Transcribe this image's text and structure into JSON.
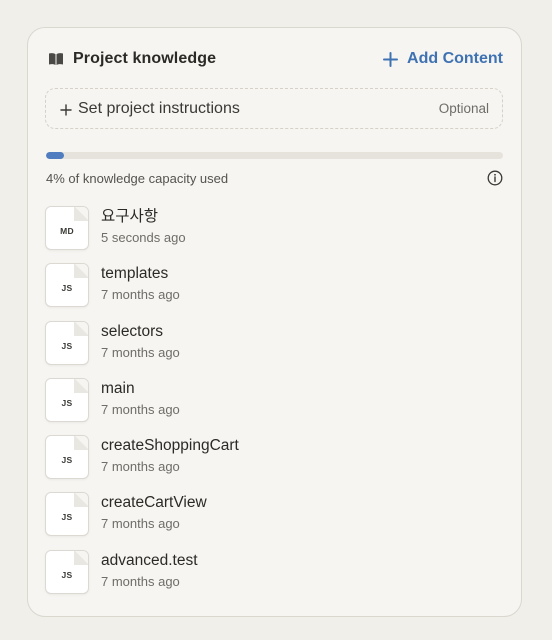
{
  "header": {
    "title": "Project knowledge",
    "add_label": "Add Content"
  },
  "instructions": {
    "label": "Set project instructions",
    "optional": "Optional"
  },
  "capacity": {
    "percent": 4,
    "text": "4% of knowledge capacity used"
  },
  "colors": {
    "accent": "#3f72b3",
    "bar_fill": "#4f7dbf",
    "background": "#f1efea"
  },
  "files": [
    {
      "ext": "MD",
      "name": "요구사항",
      "time": "5 seconds ago"
    },
    {
      "ext": "JS",
      "name": "templates",
      "time": "7 months ago"
    },
    {
      "ext": "JS",
      "name": "selectors",
      "time": "7 months ago"
    },
    {
      "ext": "JS",
      "name": "main",
      "time": "7 months ago"
    },
    {
      "ext": "JS",
      "name": "createShoppingCart",
      "time": "7 months ago"
    },
    {
      "ext": "JS",
      "name": "createCartView",
      "time": "7 months ago"
    },
    {
      "ext": "JS",
      "name": "advanced.test",
      "time": "7 months ago"
    }
  ],
  "icons": {
    "title": "book-icon",
    "add": "plus-icon",
    "info": "info-icon"
  }
}
